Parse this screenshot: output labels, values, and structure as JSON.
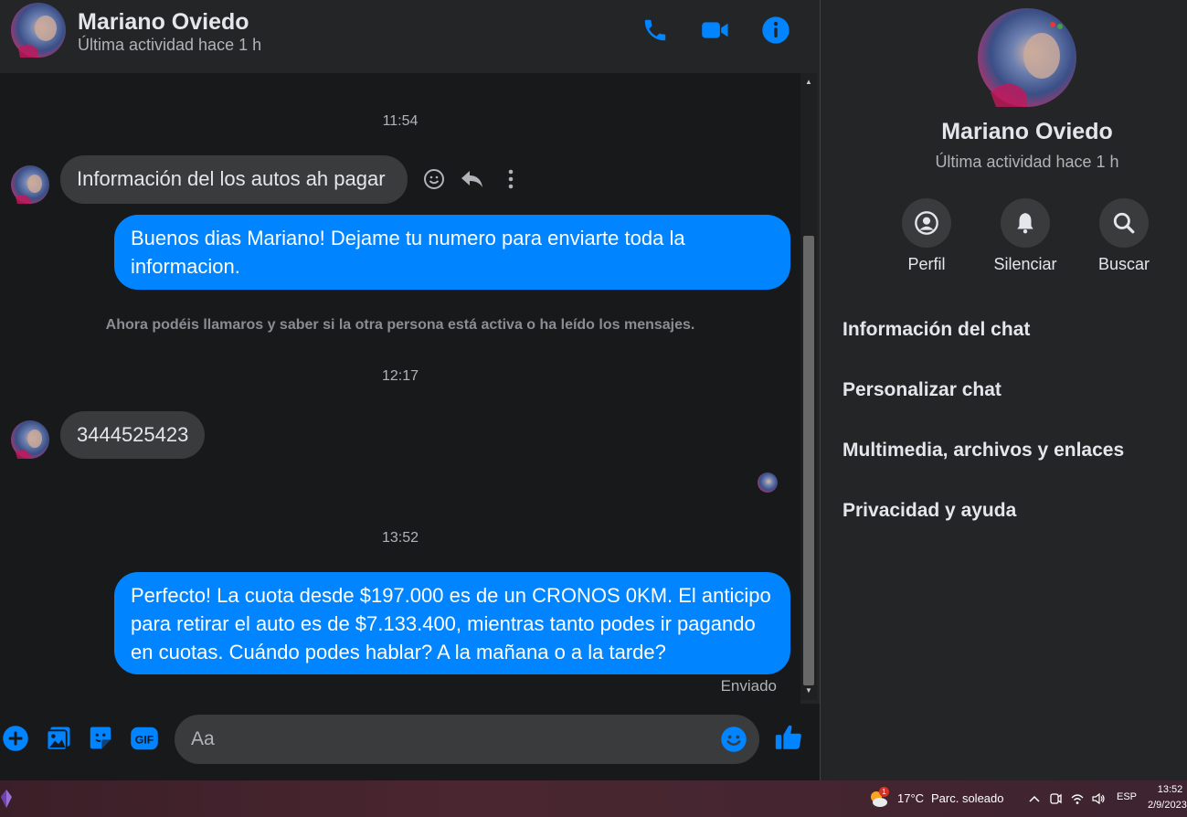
{
  "contact": {
    "name": "Mariano Oviedo",
    "status": "Última actividad hace 1 h"
  },
  "header_actions": [
    {
      "name": "call",
      "icon": "phone-icon"
    },
    {
      "name": "video-call",
      "icon": "video-camera-icon"
    },
    {
      "name": "info",
      "icon": "info-icon"
    }
  ],
  "messages": {
    "timestamps": [
      "11:54",
      "12:17",
      "13:52"
    ],
    "m1_text": "Información del los autos ah pagar",
    "m2_text": "Buenos dias Mariano! Dejame tu numero para enviarte toda la informacion.",
    "notice": "Ahora podéis llamaros y saber si la otra persona está activa o ha leído los mensajes.",
    "m3_text": "3444525423",
    "m4_text": "Perfecto! La cuota desde $197.000 es de un CRONOS 0KM. El anticipo para retirar el auto es de $7.133.400, mientras tanto podes ir pagando en cuotas. Cuándo podes hablar? A la mañana o a la tarde?",
    "delivery_status": "Enviado"
  },
  "composer": {
    "placeholder": "Aa",
    "icons": [
      "plus-icon",
      "gallery-icon",
      "sticker-icon",
      "gif-icon",
      "emoji-icon",
      "like-icon"
    ]
  },
  "side_panel": {
    "name": "Mariano Oviedo",
    "status": "Última actividad hace 1 h",
    "actions": [
      {
        "label": "Perfil",
        "icon": "profile-icon"
      },
      {
        "label": "Silenciar",
        "icon": "bell-icon"
      },
      {
        "label": "Buscar",
        "icon": "search-icon"
      }
    ],
    "sections": [
      "Información del chat",
      "Personalizar chat",
      "Multimedia, archivos y enlaces",
      "Privacidad y ayuda"
    ]
  },
  "taskbar": {
    "temperature": "17°C",
    "condition": "Parc. soleado",
    "weather_badge": "1",
    "language": "ESP",
    "time": "13:52",
    "date": "2/9/2023"
  },
  "colors": {
    "accent": "#0084ff",
    "background": "#242526",
    "thread_background": "#18191a",
    "incoming_bubble": "#3a3b3c"
  }
}
